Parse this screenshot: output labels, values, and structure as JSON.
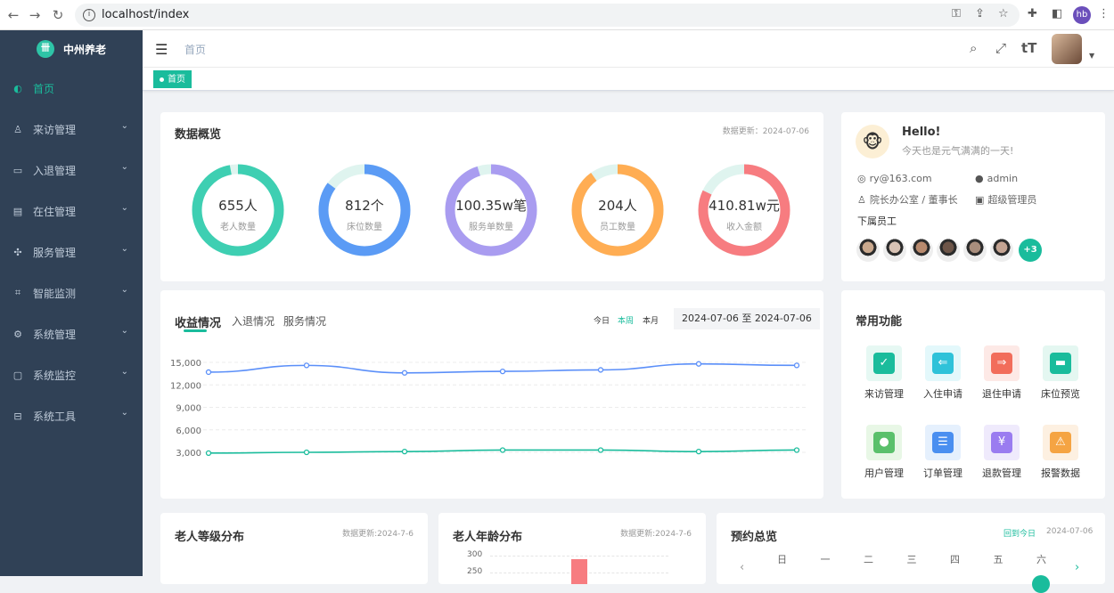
{
  "browser": {
    "url": "localhost/index",
    "profile": "hb"
  },
  "sidebar": {
    "brand": "中州养老",
    "items": [
      {
        "label": "首页",
        "icon": "dashboard-icon",
        "active": true
      },
      {
        "label": "来访管理",
        "icon": "visitor-icon"
      },
      {
        "label": "入退管理",
        "icon": "checkin-icon"
      },
      {
        "label": "在住管理",
        "icon": "resident-icon"
      },
      {
        "label": "服务管理",
        "icon": "service-icon"
      },
      {
        "label": "智能监测",
        "icon": "monitor-icon"
      },
      {
        "label": "系统管理",
        "icon": "gear-icon"
      },
      {
        "label": "系统监控",
        "icon": "screen-icon"
      },
      {
        "label": "系统工具",
        "icon": "toolbox-icon"
      }
    ]
  },
  "navbar": {
    "breadcrumb": "首页"
  },
  "tags": {
    "home": "首页"
  },
  "overview": {
    "title": "数据概览",
    "updated": "数据更新：2024-07-06",
    "rings": [
      {
        "value": "655人",
        "label": "老人数量",
        "color": "#3ecfb2",
        "fill": 0.97
      },
      {
        "value": "812个",
        "label": "床位数量",
        "color": "#5b9bf5",
        "fill": 0.85
      },
      {
        "value": "100.35w笔",
        "label": "服务单数量",
        "color": "#a99cf0",
        "fill": 0.95
      },
      {
        "value": "204人",
        "label": "员工数量",
        "color": "#ffad53",
        "fill": 0.9
      },
      {
        "value": "410.81w元",
        "label": "收入金额",
        "color": "#f77c80",
        "fill": 0.82
      }
    ]
  },
  "profile": {
    "hello": "Hello!",
    "greeting": "今天也是元气满满的一天!",
    "email": "ry@163.com",
    "username": "admin",
    "dept": "院长办公室 / 董事长",
    "role": "超级管理员",
    "subordinates_title": "下属员工",
    "more": "+3"
  },
  "revenue": {
    "tabs": [
      "收益情况",
      "入退情况",
      "服务情况"
    ],
    "periods": [
      "今日",
      "本周",
      "本月"
    ],
    "range": "2024-07-06 至 2024-07-06"
  },
  "chart_data": {
    "type": "line",
    "x": [
      1,
      2,
      3,
      4,
      5,
      6,
      7
    ],
    "yticks": [
      "15,000",
      "12,000",
      "9,000",
      "6,000",
      "3,000"
    ],
    "ylim": [
      3000,
      15000
    ],
    "series": [
      {
        "color": "#5b8ff9",
        "values": [
          13700,
          14600,
          13600,
          13800,
          14000,
          14800,
          14600
        ]
      },
      {
        "color": "#1abc9c",
        "values": [
          2900,
          3000,
          3100,
          3300,
          3300,
          3100,
          3300
        ]
      }
    ]
  },
  "functions": {
    "title": "常用功能",
    "items": [
      {
        "label": "来访管理",
        "bg": "#e6f8f3",
        "fg": "#1abc9c",
        "glyph": "✓"
      },
      {
        "label": "入住申请",
        "bg": "#e3f8fb",
        "fg": "#2fc2d9",
        "glyph": "⇐"
      },
      {
        "label": "退住申请",
        "bg": "#fde9e6",
        "fg": "#f26d5b",
        "glyph": "⇒"
      },
      {
        "label": "床位预览",
        "bg": "#e4f7f1",
        "fg": "#1abc9c",
        "glyph": "▬"
      },
      {
        "label": "用户管理",
        "bg": "#e8f7e6",
        "fg": "#5ac06b",
        "glyph": "●"
      },
      {
        "label": "订单管理",
        "bg": "#e5f0fd",
        "fg": "#4a8ff0",
        "glyph": "☰"
      },
      {
        "label": "退款管理",
        "bg": "#efeafc",
        "fg": "#9a7cf0",
        "glyph": "¥"
      },
      {
        "label": "报警数据",
        "bg": "#fdf0e1",
        "fg": "#f5a443",
        "glyph": "⚠"
      }
    ]
  },
  "level": {
    "title": "老人等级分布",
    "updated": "数据更新:2024-7-6"
  },
  "age": {
    "title": "老人年龄分布",
    "updated": "数据更新:2024-7-6",
    "yticks": [
      "300",
      "250"
    ]
  },
  "booking": {
    "title": "预约总览",
    "today_link": "回到今日",
    "date": "2024-07-06",
    "weekdays": [
      "日",
      "一",
      "二",
      "三",
      "四",
      "五",
      "六"
    ]
  }
}
